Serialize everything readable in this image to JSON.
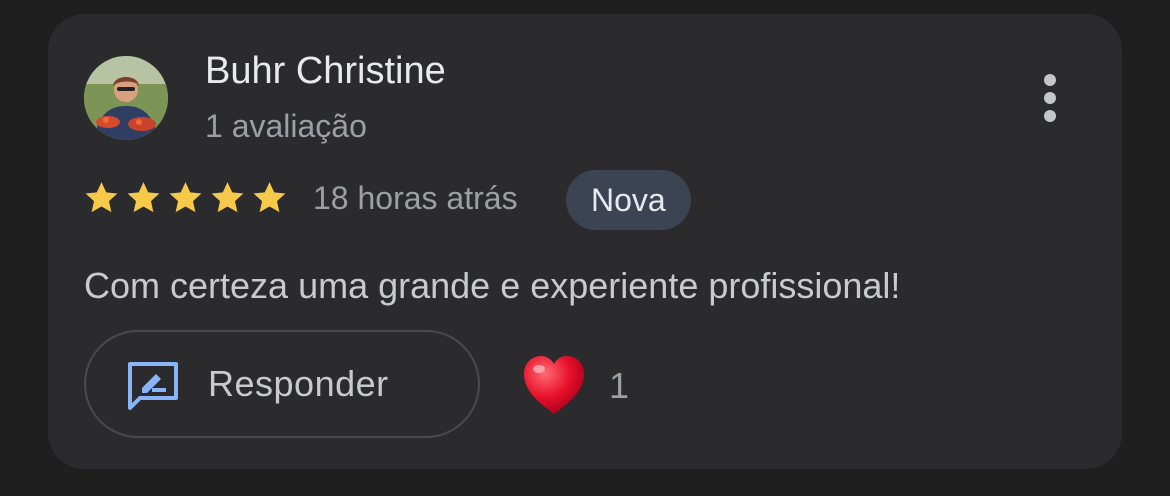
{
  "review": {
    "reviewer_name": "Buhr Christine",
    "review_count": "1 avaliação",
    "rating": 5,
    "rating_max": 5,
    "time_ago": "18 horas atrás",
    "badge": "Nova",
    "text": "Com certeza uma grande e experiente profissional!"
  },
  "actions": {
    "reply_label": "Responder",
    "reaction_count": "1"
  },
  "icons": {
    "avatar": "reviewer-photo",
    "more": "more-vert-icon",
    "star": "star-icon",
    "reply": "reply-icon",
    "reaction": "heart-icon"
  },
  "colors": {
    "star": "#f7c948",
    "reply_icon": "#8ab4f8",
    "heart": "#e8102a",
    "badge_bg": "#3c4453"
  }
}
